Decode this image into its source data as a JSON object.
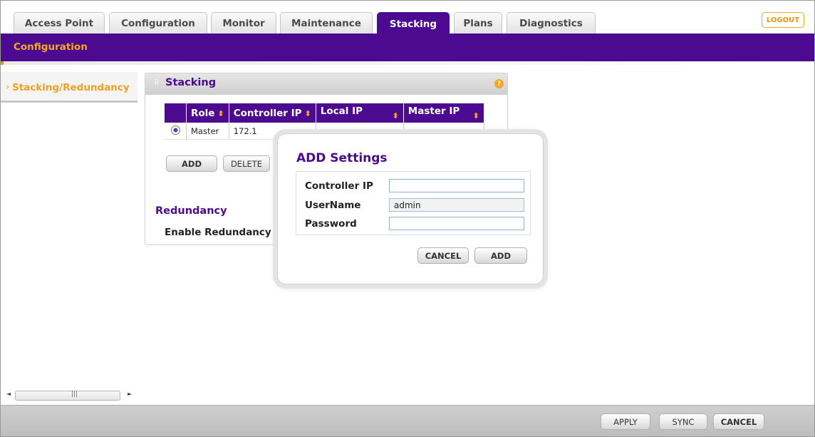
{
  "tabs": [
    {
      "label": "Access Point",
      "active": false
    },
    {
      "label": "Configuration",
      "active": false
    },
    {
      "label": "Monitor",
      "active": false
    },
    {
      "label": "Maintenance",
      "active": false
    },
    {
      "label": "Stacking",
      "active": true
    },
    {
      "label": "Plans",
      "active": false
    },
    {
      "label": "Diagnostics",
      "active": false
    }
  ],
  "logout_label": "LOGOUT",
  "subnav": {
    "label": "Configuration"
  },
  "sidebar": {
    "items": [
      {
        "label": "Stacking/Redundancy",
        "active": true
      }
    ]
  },
  "panel": {
    "title": "Stacking",
    "help_icon": "?",
    "table": {
      "headers": [
        "Role",
        "Controller IP",
        "Local IP",
        "Master IP"
      ],
      "rows": [
        {
          "selected": true,
          "role": "Master",
          "controller_ip": "172.1"
        }
      ]
    },
    "add_button": "ADD",
    "delete_button": "DELETE",
    "redundancy": {
      "title": "Redundancy",
      "enable_label": "Enable Redundancy"
    }
  },
  "dialog": {
    "title": "ADD Settings",
    "fields": [
      {
        "label": "Controller IP",
        "value": ""
      },
      {
        "label": "UserName",
        "value": "admin"
      },
      {
        "label": "Password",
        "value": ""
      }
    ],
    "cancel_button": "CANCEL",
    "add_button": "ADD"
  },
  "footer": {
    "apply": "APPLY",
    "sync": "SYNC",
    "cancel": "CANCEL"
  },
  "colors": {
    "brand_purple": "#4b0a8f",
    "accent_orange": "#f5a623"
  }
}
